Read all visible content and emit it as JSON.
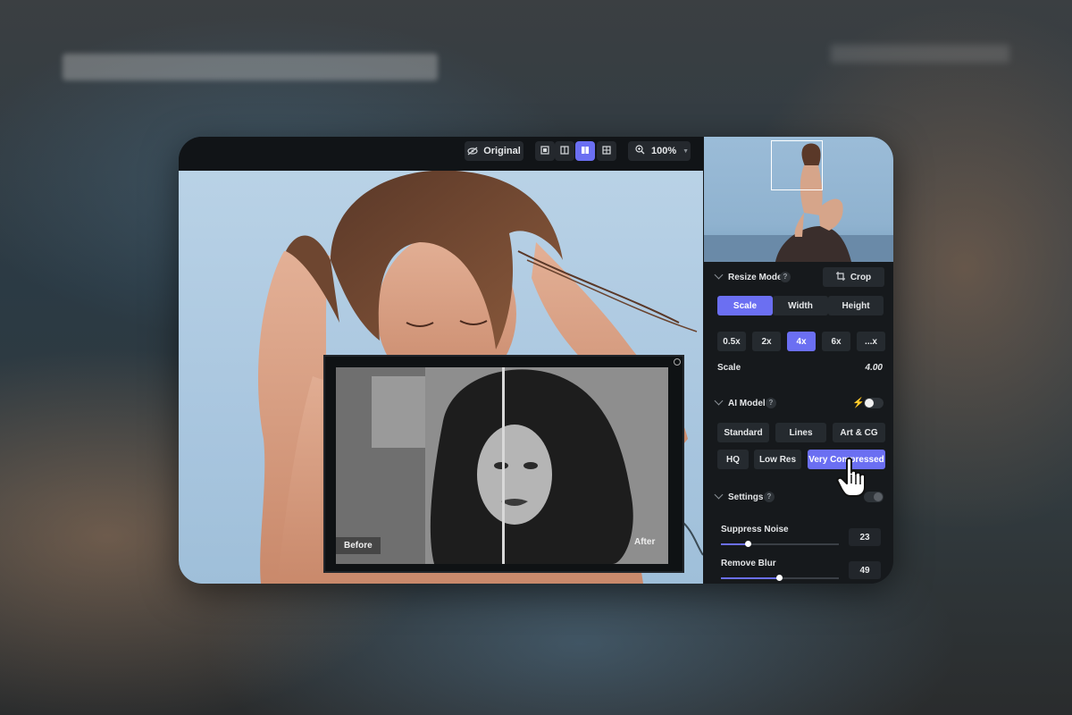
{
  "toolbar": {
    "original_label": "Original",
    "zoom_value": "100%",
    "view_modes": [
      "single-view",
      "side-by-side",
      "split-view",
      "grid-view"
    ],
    "active_view": "split-view"
  },
  "compare": {
    "before_label": "Before",
    "after_label": "After",
    "split_position": 0.5
  },
  "panel": {
    "resize_mode": {
      "title": "Resize Mode",
      "help": "?",
      "crop_label": "Crop",
      "tabs": [
        "Scale",
        "Width",
        "Height"
      ],
      "active_tab": "Scale",
      "scale_options": [
        "0.5x",
        "2x",
        "4x",
        "6x",
        "...x"
      ],
      "active_scale": "4x",
      "scale_label": "Scale",
      "scale_value": "4.00"
    },
    "ai_model": {
      "title": "AI Model",
      "help": "?",
      "toggle_on": true,
      "models_row1": [
        "Standard",
        "Lines",
        "Art & CG"
      ],
      "models_row2": [
        "HQ",
        "Low Res",
        "Very Compressed"
      ],
      "active_model": "Very Compressed"
    },
    "settings": {
      "title": "Settings",
      "help": "?",
      "suppress_noise_label": "Suppress Noise",
      "suppress_noise_value": "23",
      "suppress_noise_level": 0.23,
      "remove_blur_label": "Remove Blur",
      "remove_blur_value": "49",
      "remove_blur_level": 0.49
    }
  },
  "colors": {
    "accent": "#6b6ff2",
    "panel_bg": "#16191c",
    "button_bg": "#252a2f"
  }
}
